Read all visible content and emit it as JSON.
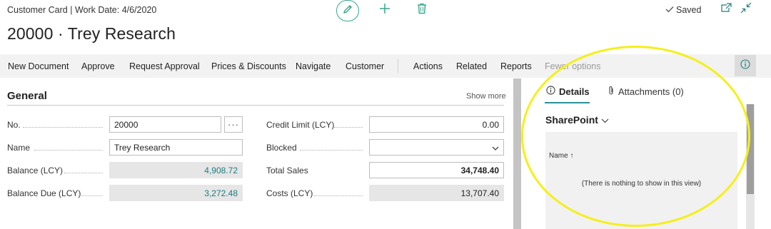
{
  "header": {
    "breadcrumb": "Customer Card | Work Date: 4/6/2020",
    "title": "20000 · Trey Research",
    "saved_label": "Saved"
  },
  "icons": {
    "edit": "pencil-icon",
    "new": "plus-icon",
    "delete": "trash-icon",
    "saved": "checkmark-icon",
    "popout": "popout-icon",
    "collapse": "collapse-icon",
    "factbox_toggle": "info-icon",
    "details_tab": "info-icon",
    "attachments_tab": "paperclip-icon"
  },
  "colors": {
    "accent": "#36a58f",
    "link": "#1d7c80",
    "annotation": "#f5ef1b"
  },
  "actions": {
    "new_document": "New Document",
    "approve": "Approve",
    "request_approval": "Request Approval",
    "prices_discounts": "Prices & Discounts",
    "navigate": "Navigate",
    "customer": "Customer",
    "actions": "Actions",
    "related": "Related",
    "reports": "Reports",
    "fewer_options": "Fewer options"
  },
  "general": {
    "title": "General",
    "show_more": "Show more",
    "no_label": "No.",
    "no_value": "20000",
    "lookup_button": "···",
    "name_label": "Name",
    "name_value": "Trey Research",
    "balance_label": "Balance (LCY)",
    "balance_value": "4,908.72",
    "balance_due_label": "Balance Due (LCY)",
    "balance_due_value": "3,272.48",
    "credit_limit_label": "Credit Limit (LCY)",
    "credit_limit_value": "0.00",
    "blocked_label": "Blocked",
    "blocked_value": "",
    "total_sales_label": "Total Sales",
    "total_sales_value": "34,748.40",
    "costs_label": "Costs (LCY)",
    "costs_value": "13,707.40"
  },
  "factbox": {
    "details_tab": "Details",
    "attachments_tab": "Attachments (0)",
    "sharepoint_title": "SharePoint",
    "name_column": "Name ↑",
    "empty_text": "(There is nothing to show in this view)"
  }
}
